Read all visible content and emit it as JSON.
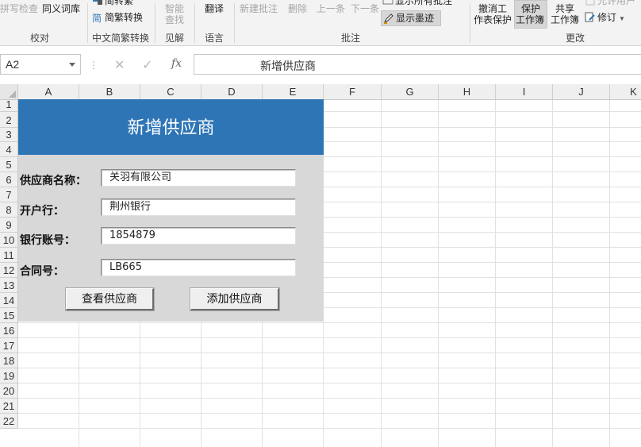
{
  "ribbon": {
    "proofing": {
      "spell": "拼写检查",
      "thesaurus": "同义词库",
      "group": "校对"
    },
    "chinese": {
      "to_simplified": "简转繁",
      "to_traditional": "简繁转换",
      "group": "中文简繁转换"
    },
    "insights": {
      "smart_lookup_1": "智能",
      "smart_lookup_2": "查找",
      "group": "见解"
    },
    "language": {
      "translate": "翻译",
      "group": "语言"
    },
    "comments": {
      "new": "新建批注",
      "delete": "删除",
      "prev": "上一条",
      "next": "下一条",
      "show_all": "显示所有批注",
      "show_ink": "显示墨迹",
      "group": "批注"
    },
    "changes": {
      "unprotect_1": "撤消工",
      "unprotect_2": "作表保护",
      "protect_1": "保护",
      "protect_2": "工作簿",
      "share_1": "共享",
      "share_2": "工作簿",
      "allow_users": "允许用户",
      "track": "修订",
      "group": "更改"
    }
  },
  "formula_bar": {
    "name_box": "A2",
    "cancel": "✕",
    "enter": "✓",
    "fx": "fx",
    "content": "新增供应商"
  },
  "columns": [
    "A",
    "B",
    "C",
    "D",
    "E",
    "F",
    "G",
    "H",
    "I",
    "J",
    "K"
  ],
  "rows": [
    "1",
    "2",
    "3",
    "4",
    "5",
    "6",
    "7",
    "8",
    "9",
    "10",
    "11",
    "12",
    "13",
    "14",
    "15",
    "16",
    "17",
    "18",
    "19",
    "20",
    "21",
    "22"
  ],
  "form": {
    "title": "新增供应商",
    "supplier_label": "供应商名称：",
    "supplier_value": "关羽有限公司",
    "bank_label": "开户行：",
    "bank_value": "荆州银行",
    "account_label": "银行账号：",
    "account_value": "1854879",
    "contract_label": "合同号：",
    "contract_value": "LB665",
    "view_button": "查看供应商",
    "add_button": "添加供应商"
  },
  "colors": {
    "banner": "#2e75b6",
    "panel": "#d8d8d8"
  }
}
